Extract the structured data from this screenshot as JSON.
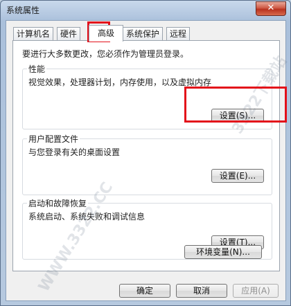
{
  "window": {
    "title": "系统属性",
    "close_label": "✕"
  },
  "tabs": [
    {
      "label": "计算机名"
    },
    {
      "label": "硬件"
    },
    {
      "label": "高级"
    },
    {
      "label": "系统保护"
    },
    {
      "label": "远程"
    }
  ],
  "notice": "要进行大多数更改，您必须作为管理员登录。",
  "groups": {
    "performance": {
      "title": "性能",
      "desc": "视觉效果，处理器计划，内存使用，以及虚拟内存",
      "button": "设置(S)..."
    },
    "profile": {
      "title": "用户配置文件",
      "desc": "与您登录有关的桌面设置",
      "button": "设置(E)..."
    },
    "startup": {
      "title": "启动和故障恢复",
      "desc": "系统启动、系统失败和调试信息",
      "button": "设置(T)..."
    }
  },
  "env_button": "环境变量(N)...",
  "footer": {
    "ok": "确定",
    "cancel": "取消",
    "apply": "应用(A)"
  },
  "watermark": {
    "text_a": "WWW.3322.CC",
    "text_b": "3322下载站"
  },
  "colors": {
    "highlight": "#e3101a"
  }
}
